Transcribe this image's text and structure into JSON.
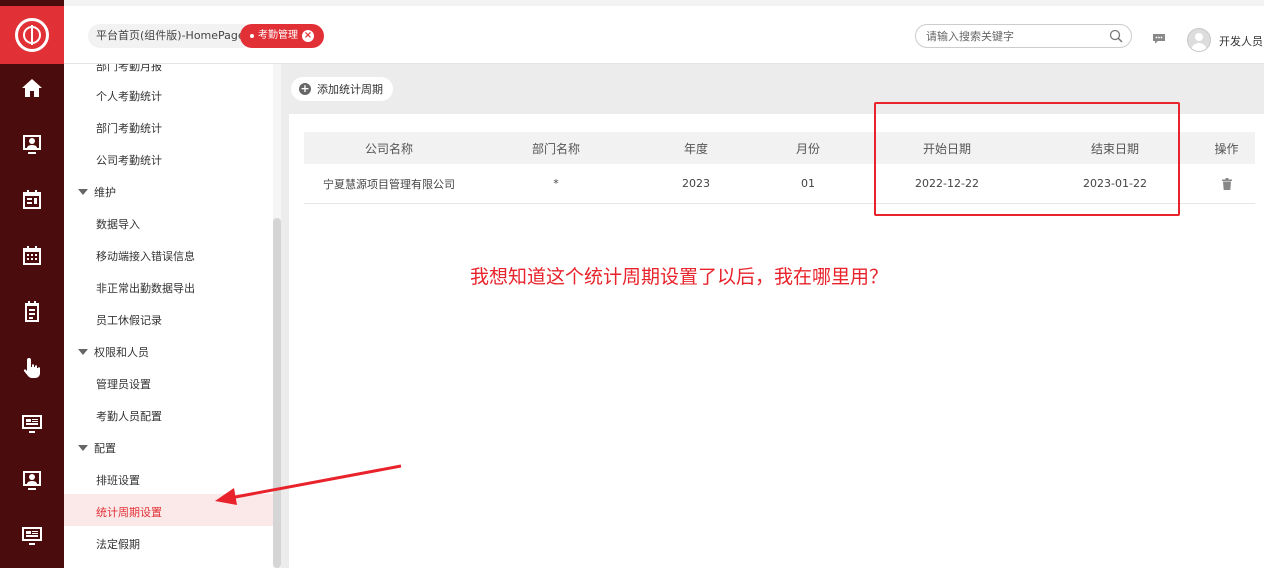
{
  "header": {
    "home_tab": "平台首页(组件版)-HomePage",
    "active_tab": "考勤管理",
    "search_placeholder": "请输入搜索关键字",
    "user_name": "开发人员"
  },
  "submenu": {
    "partial_top": "部门考勤月报",
    "items_a": [
      "个人考勤统计",
      "部门考勤统计",
      "公司考勤统计"
    ],
    "group_maintain": "维护",
    "items_maintain": [
      "数据导入",
      "移动端接入错误信息",
      "非正常出勤数据导出",
      "员工休假记录"
    ],
    "group_perm": "权限和人员",
    "items_perm": [
      "管理员设置",
      "考勤人员配置"
    ],
    "group_config": "配置",
    "items_config": [
      "排班设置",
      "统计周期设置",
      "法定假期"
    ]
  },
  "toolbar": {
    "add_label": "添加统计周期"
  },
  "table": {
    "headers": [
      "公司名称",
      "部门名称",
      "年度",
      "月份",
      "开始日期",
      "结束日期",
      "操作"
    ],
    "rows": [
      [
        "宁夏慧源项目管理有限公司",
        "*",
        "2023",
        "01",
        "2022-12-22",
        "2023-01-22"
      ]
    ]
  },
  "annotation": {
    "question": "我想知道这个统计周期设置了以后，我在哪里用？"
  },
  "colors": {
    "brand_red": "#e13036",
    "rail_bg": "#4a0c0c",
    "annotation_red": "#e8232b"
  },
  "icons": {
    "rail": [
      "home-icon",
      "user-card-icon",
      "calendar-list-icon",
      "calendar-grid-icon",
      "notepad-icon",
      "touch-icon",
      "monitor-icon",
      "user-card-icon",
      "monitor-icon"
    ]
  }
}
